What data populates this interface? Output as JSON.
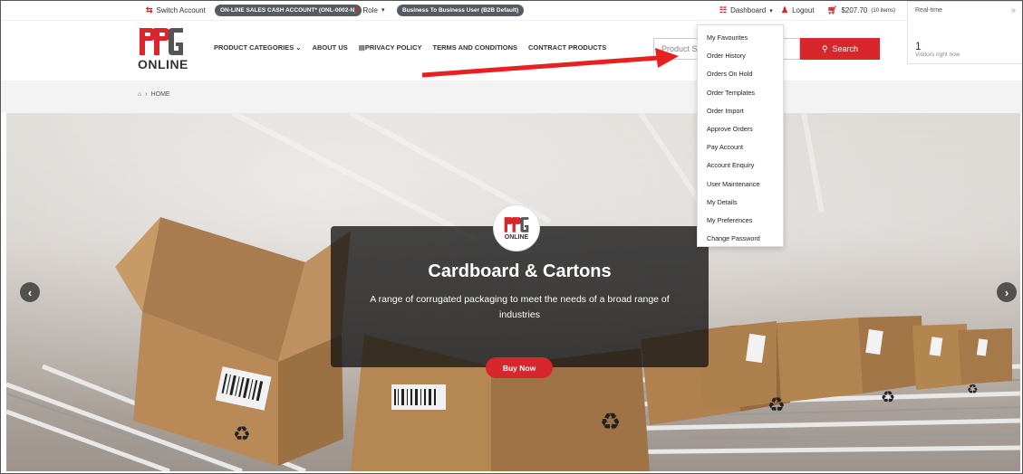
{
  "topbar": {
    "switch_account": "Switch Account",
    "account_pill": "ON-LINE SALES CASH ACCOUNT* (ONL-0002-N)",
    "role_label": "Role",
    "role_pill": "Business To Business User (B2B Default)",
    "dashboard": "Dashboard",
    "logout": "Logout",
    "cart_total": "$207.70",
    "cart_items": "(10 items)"
  },
  "header": {
    "logo_text": "ONLINE",
    "nav": [
      "PRODUCT CATEGORIES",
      "ABOUT US",
      "PRIVACY POLICY",
      "TERMS AND CONDITIONS",
      "CONTRACT PRODUCTS"
    ],
    "search_placeholder": "Product Se",
    "search_button": "Search"
  },
  "realtime": {
    "title": "Real-time",
    "count": "1",
    "label": "Visitors right now"
  },
  "breadcrumb": {
    "home": "HOME"
  },
  "hero": {
    "logo_text": "ONLINE",
    "title": "Cardboard & Cartons",
    "subtitle": "A range of corrugated packaging to meet the needs of a broad range of industries",
    "button": "Buy Now"
  },
  "dropdown": {
    "items": [
      "My Favourites",
      "Order History",
      "Orders On Hold",
      "Order Templates",
      "Order Import",
      "Approve Orders",
      "Pay Account",
      "Account Enquiry",
      "User Maintenance",
      "My Details",
      "My Preferences",
      "Change Password"
    ]
  },
  "colors": {
    "brand_red": "#d8262d",
    "pill_grey": "#555a63"
  },
  "icons": {
    "switch": "switch-account-icon",
    "role": "role-icon",
    "dashboard": "dashboard-icon",
    "logout": "user-icon",
    "cart": "cart-icon",
    "home": "home-icon",
    "prev": "chevron-left-icon",
    "next": "chevron-right-icon"
  }
}
